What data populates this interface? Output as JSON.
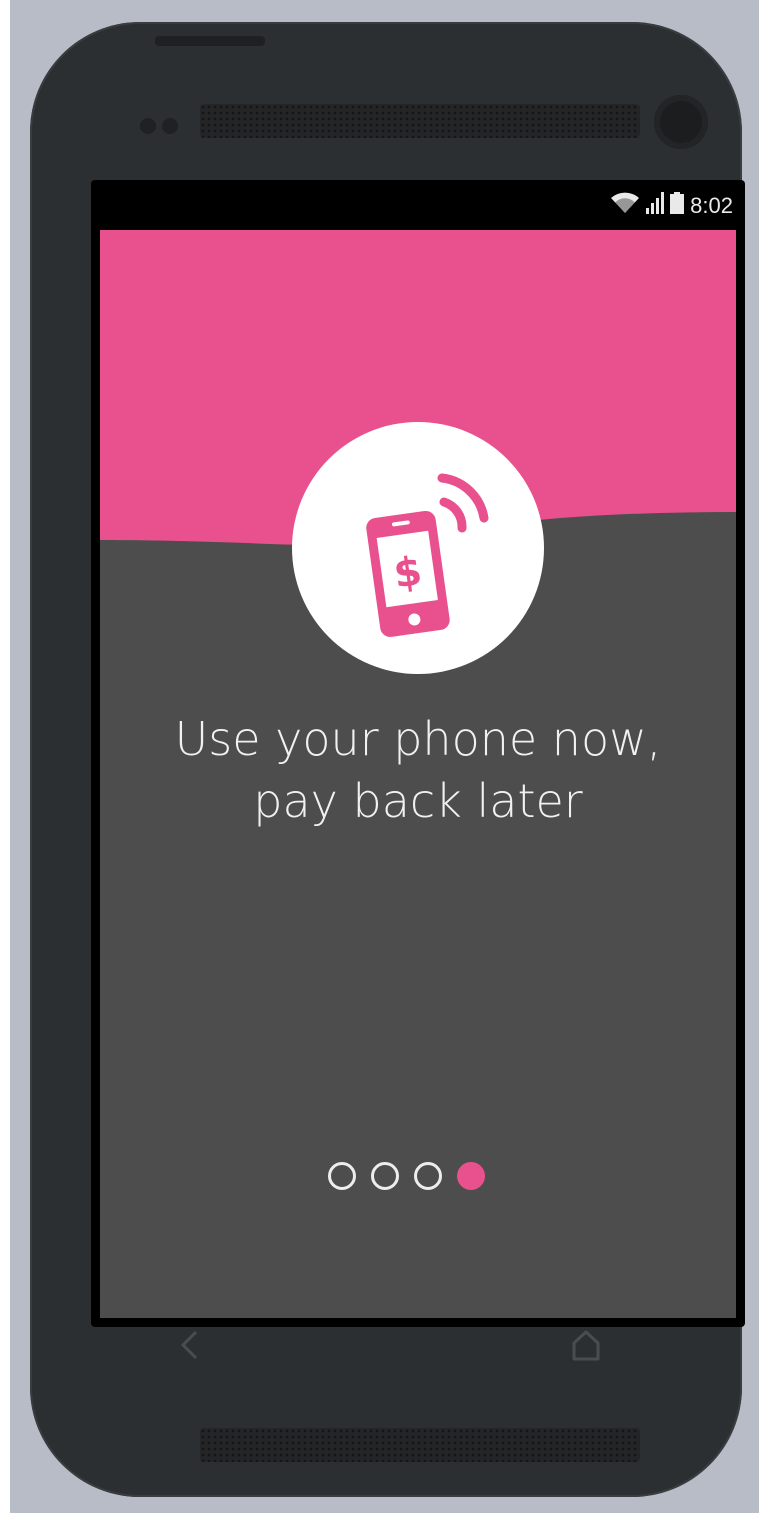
{
  "status_bar": {
    "time": "8:02",
    "icons": [
      "wifi-icon",
      "signal-icon",
      "battery-icon"
    ]
  },
  "onboarding": {
    "headline_line1": "Use your phone now,",
    "headline_line2": "pay back later",
    "hero_icon": "phone-payment-icon",
    "pager": {
      "total_pages": 4,
      "active_page": 4
    }
  },
  "nav": {
    "back_icon": "back-icon",
    "home_icon": "home-icon"
  },
  "colors": {
    "accent": "#e9508e",
    "content_background": "#4d4d4d",
    "phone_body": "#2c2f31",
    "page_background": "#b7bcc6"
  }
}
